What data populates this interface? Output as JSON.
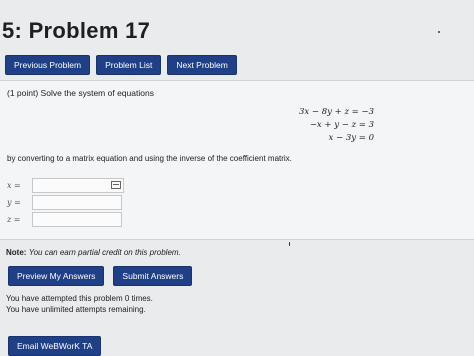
{
  "page": {
    "title": "5: Problem 17"
  },
  "nav": {
    "previous": "Previous Problem",
    "list": "Problem List",
    "next": "Next Problem"
  },
  "problem": {
    "intro": "(1 point) Solve the system of equations",
    "equations": [
      "3x − 8y + z = −3",
      "−x + y − z = 3",
      "x − 3y = 0"
    ],
    "instruction": "by converting to a matrix equation and using the inverse of the coefficient matrix.",
    "answers": [
      {
        "label": "x =",
        "value": ""
      },
      {
        "label": "y =",
        "value": ""
      },
      {
        "label": "z =",
        "value": ""
      }
    ]
  },
  "note": {
    "label": "Note:",
    "text": "You can earn partial credit on this problem."
  },
  "actions": {
    "preview": "Preview My Answers",
    "submit": "Submit Answers"
  },
  "status": {
    "attempts": "You have attempted this problem 0 times.",
    "remaining": "You have unlimited attempts remaining."
  },
  "footer": {
    "email": "Email WeBWorK TA"
  },
  "icons": {
    "matrix_input": "matrix-icon"
  },
  "colors": {
    "button": "#1f3f87",
    "background": "#e9ebec",
    "panel": "#f4f5f6"
  }
}
